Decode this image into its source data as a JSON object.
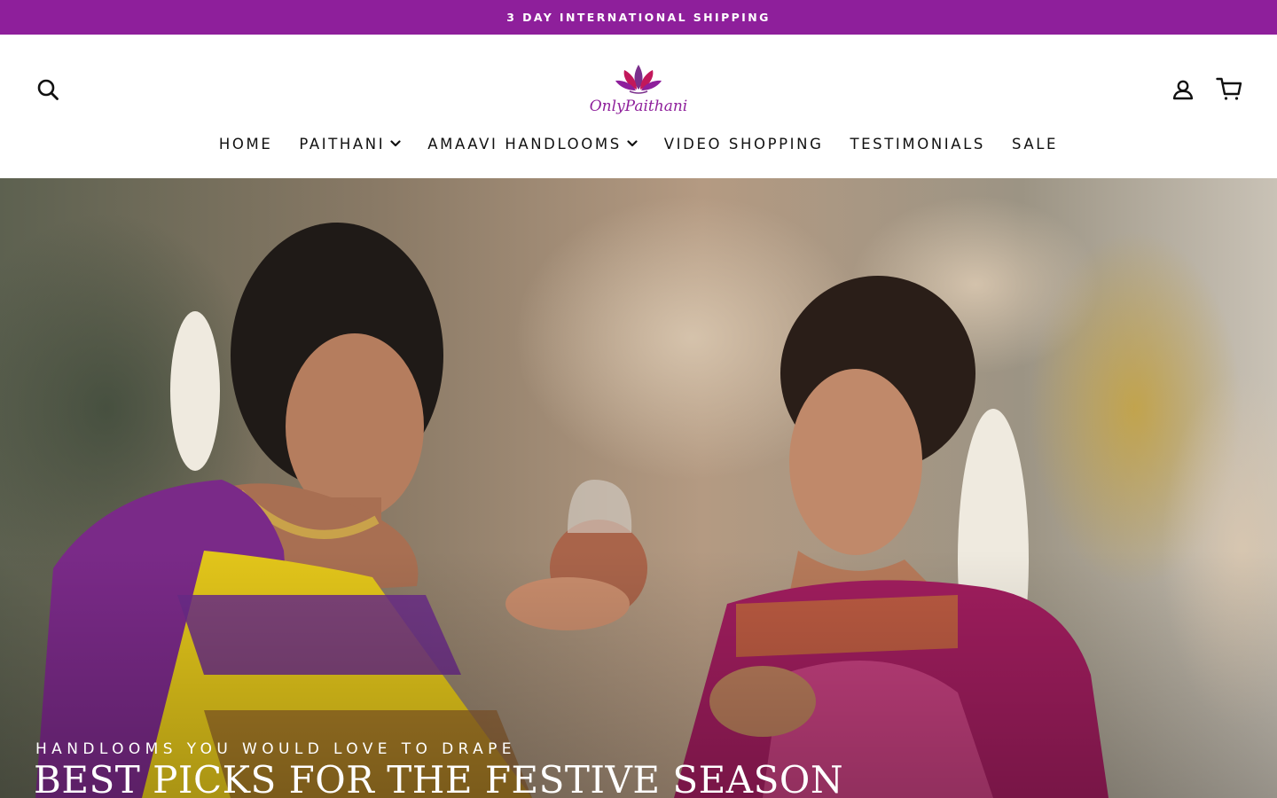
{
  "announcement": {
    "text": "3 DAY INTERNATIONAL SHIPPING",
    "background": "#8e1f9b"
  },
  "header": {
    "logo_text": "OnlyPaithani",
    "icons": {
      "search": "search-icon",
      "account": "user-icon",
      "cart": "cart-icon"
    }
  },
  "nav": {
    "items": [
      {
        "label": "HOME",
        "dropdown": false
      },
      {
        "label": "PAITHANI",
        "dropdown": true
      },
      {
        "label": "AMAAVI HANDLOOMS",
        "dropdown": true
      },
      {
        "label": "VIDEO SHOPPING",
        "dropdown": false
      },
      {
        "label": "TESTIMONIALS",
        "dropdown": false
      },
      {
        "label": "SALE",
        "dropdown": false
      }
    ]
  },
  "hero": {
    "subtitle": "HANDLOOMS YOU WOULD LOVE TO DRAPE",
    "title": "BEST PICKS FOR THE FESTIVE SEASON"
  },
  "colors": {
    "brand_purple": "#8e1f9b",
    "logo_pink": "#c2185b",
    "logo_violet": "#7b2f8c"
  }
}
